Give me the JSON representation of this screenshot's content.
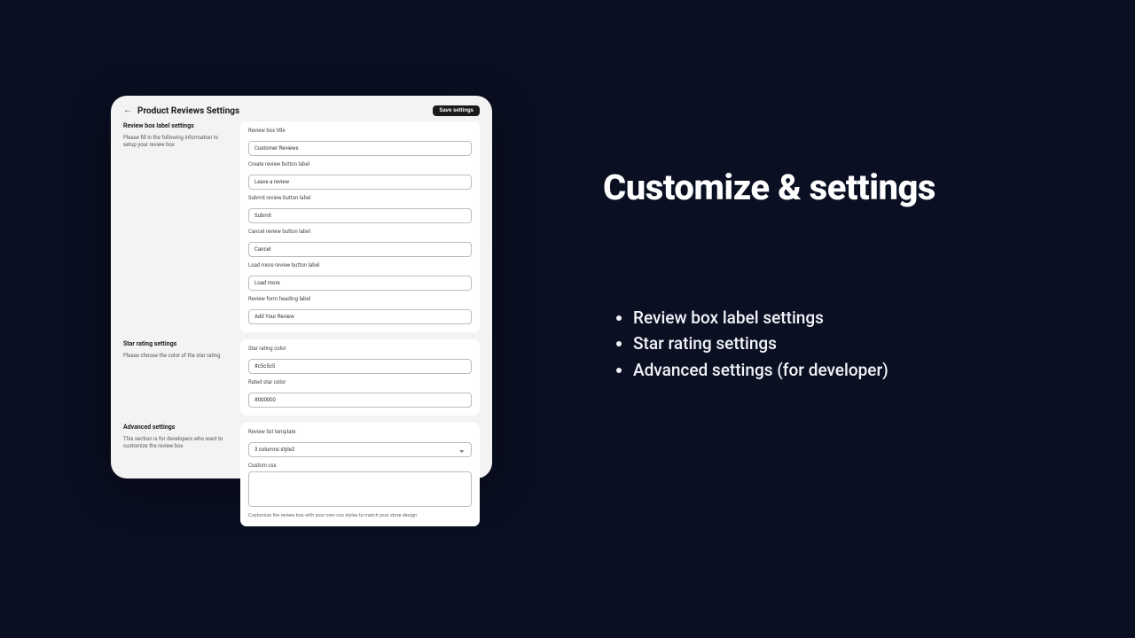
{
  "promo": {
    "title": "Customize & settings",
    "bullets": [
      "Review box label settings",
      "Star rating settings",
      "Advanced settings (for developer)"
    ]
  },
  "panel": {
    "title": "Product Reviews Settings",
    "save_label": "Save settings"
  },
  "sections": {
    "review_box": {
      "heading": "Review box label settings",
      "help": "Please fill in the following information to setup your review box",
      "fields": {
        "box_title": {
          "label": "Review box title",
          "value": "Customer Reviews"
        },
        "create_btn": {
          "label": "Create review button label",
          "value": "Leave a review"
        },
        "submit_btn": {
          "label": "Submit review button label",
          "value": "Submit"
        },
        "cancel_btn": {
          "label": "Cancel review button label",
          "value": "Cancel"
        },
        "loadmore_btn": {
          "label": "Load more review button label",
          "value": "Load more"
        },
        "form_heading": {
          "label": "Review form heading label",
          "value": "Add Your Review"
        }
      }
    },
    "star_rating": {
      "heading": "Star rating settings",
      "help": "Please choose the color of the star rating",
      "fields": {
        "rating_color": {
          "label": "Star rating color",
          "value": "#c5c5c5"
        },
        "rated_color": {
          "label": "Rated star color",
          "value": "#000000"
        }
      }
    },
    "advanced": {
      "heading": "Advanced settings",
      "help": "This section is for developers who want to customize the review box",
      "fields": {
        "template": {
          "label": "Review list template",
          "value": "3 columns style2"
        },
        "custom_css": {
          "label": "Custom css",
          "value": "",
          "note": "Customize the review box with your own css styles to match your store design"
        }
      }
    }
  }
}
